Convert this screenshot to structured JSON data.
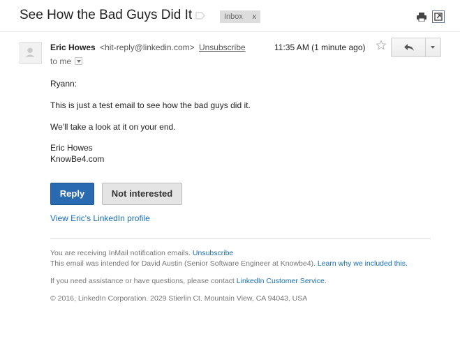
{
  "subject": "See How the Bad Guys Did It",
  "labels": {
    "inbox": "Inbox",
    "inbox_remove": "x"
  },
  "message": {
    "from_name": "Eric Howes",
    "from_email": "<hit-reply@linkedin.com>",
    "unsubscribe": "Unsubscribe",
    "to_line": "to me",
    "timestamp": "11:35 AM (1 minute ago)"
  },
  "body": {
    "greeting": "Ryann:",
    "para1": "This is just a test email to see how the bad guys did it.",
    "para2": "We'll take a look at it on your end.",
    "signature_name": "Eric Howes",
    "signature_company": "KnowBe4.com"
  },
  "actions": {
    "reply": "Reply",
    "not_interested": "Not interested",
    "view_profile": "View Eric's LinkedIn profile"
  },
  "footer": {
    "line1_text": "You are receiving InMail notification emails.",
    "line1_link": "Unsubscribe",
    "line2_text": "This email was intended for David Austin (Senior Software Engineer at Knowbe4).",
    "line2_link": "Learn why we included this.",
    "line3_text": "If you need assistance or have questions, please contact",
    "line3_link": "LinkedIn Customer Service",
    "line3_end": ".",
    "copyright": "© 2016, LinkedIn Corporation. 2029 Stierlin Ct. Mountain View, CA 94043, USA"
  },
  "colors": {
    "reply_button": "#2a6ab1",
    "link": "#1a6fb5",
    "footer_text": "#777777"
  },
  "icons": [
    "label-tag-icon",
    "print-icon",
    "popout-icon",
    "avatar-placeholder",
    "star-icon",
    "reply-arrow-icon",
    "chevron-down-icon"
  ]
}
